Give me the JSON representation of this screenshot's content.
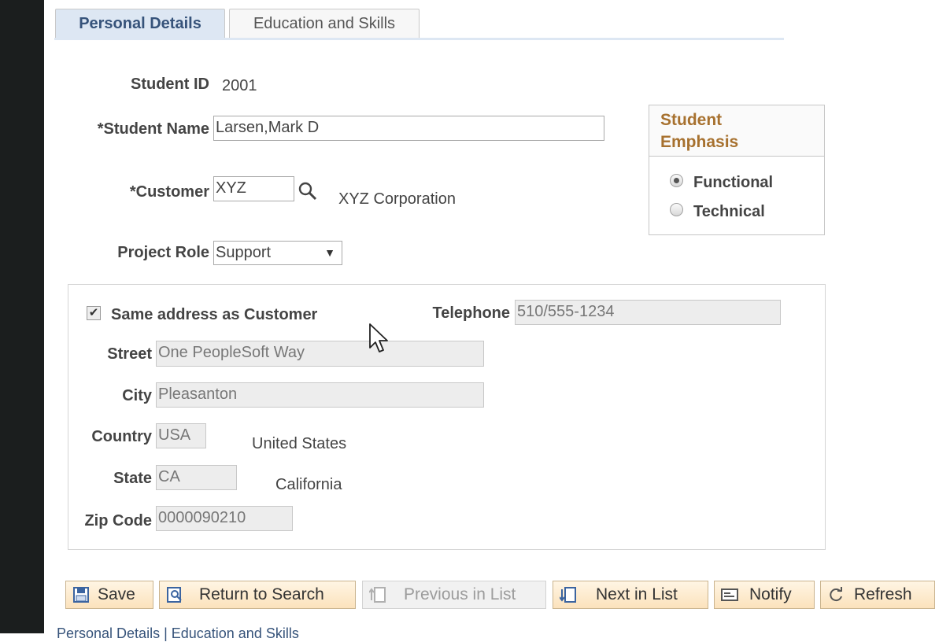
{
  "tabs": [
    {
      "label": "Personal Details",
      "active": true
    },
    {
      "label": "Education and Skills",
      "active": false
    }
  ],
  "form": {
    "student_id_label": "Student ID",
    "student_id_value": "2001",
    "student_name_label": "*Student Name",
    "student_name_value": "Larsen,Mark D",
    "customer_label": "*Customer",
    "customer_value": "XYZ",
    "customer_description": "XYZ Corporation",
    "project_role_label": "Project Role",
    "project_role_value": "Support"
  },
  "emphasis": {
    "title": "Student Emphasis",
    "options": [
      {
        "label": "Functional",
        "selected": true
      },
      {
        "label": "Technical",
        "selected": false
      }
    ]
  },
  "address": {
    "same_as_customer_label": "Same address as Customer",
    "same_as_customer_checked": true,
    "telephone_label": "Telephone",
    "telephone_value": "510/555-1234",
    "street_label": "Street",
    "street_value": "One PeopleSoft Way",
    "city_label": "City",
    "city_value": "Pleasanton",
    "country_label": "Country",
    "country_value": "USA",
    "country_description": "United States",
    "state_label": "State",
    "state_value": "CA",
    "state_description": "California",
    "zip_label": "Zip Code",
    "zip_value": "0000090210"
  },
  "toolbar": {
    "save": "Save",
    "return_to_search": "Return to Search",
    "previous_in_list": "Previous in List",
    "next_in_list": "Next in List",
    "notify": "Notify",
    "refresh": "Refresh"
  },
  "footer_links": "Personal Details | Education and Skills",
  "colors": {
    "tab_active_bg": "#dde7f3",
    "emphasis_title": "#a7712f",
    "button_bg": "#fbe2bc",
    "left_bar": "#1b1e1e"
  }
}
